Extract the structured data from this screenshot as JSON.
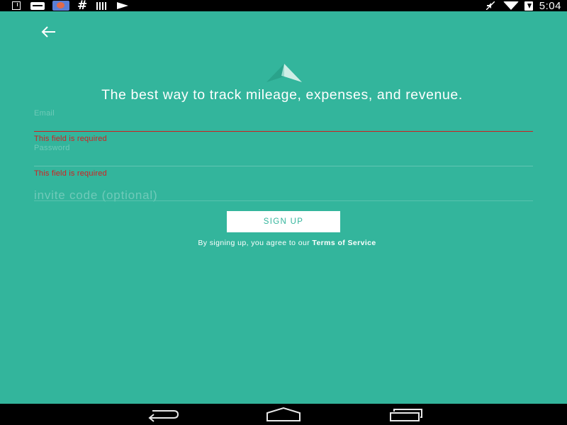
{
  "status_bar": {
    "time": "5:04",
    "left_icons": [
      "download-icon",
      "message-icon",
      "photo-icon",
      "hashtag-icon",
      "barcode-icon",
      "send-icon"
    ],
    "right_icons": [
      "mute-icon",
      "wifi-icon",
      "battery-icon"
    ]
  },
  "header": {
    "back_icon": "arrow-left-icon",
    "logo_icon": "paper-plane-icon"
  },
  "headline": "The best way to track mileage, expenses, and revenue.",
  "form": {
    "email": {
      "label": "Email",
      "value": "",
      "error": "This field is required"
    },
    "password": {
      "label": "Password",
      "value": "",
      "error": "This field is required"
    },
    "invite": {
      "placeholder": "invite code (optional)",
      "value": ""
    },
    "submit_label": "SIGN UP"
  },
  "terms": {
    "prefix": "By signing up, you agree to our ",
    "link": "Terms of Service"
  },
  "nav_bar": {
    "buttons": [
      "back-icon",
      "home-icon",
      "recents-icon"
    ]
  },
  "colors": {
    "background": "#33b59c",
    "error": "#d22020",
    "button_background": "#ffffff",
    "button_text": "#33b59c"
  }
}
